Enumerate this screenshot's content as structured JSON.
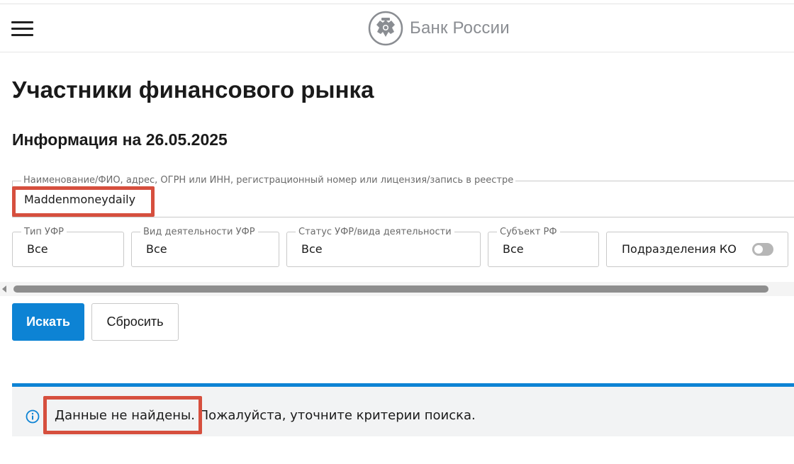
{
  "header": {
    "menu_icon": "hamburger-menu-icon",
    "logo_icon": "double-headed-eagle-emblem",
    "logo_text": "Банк России"
  },
  "page": {
    "title": "Участники финансового рынка",
    "info_date": "Информация на 26.05.2025"
  },
  "search": {
    "legend": "Наименование/ФИО, адрес, ОГРН или ИНН, регистрационный номер или лицензия/запись в реестре",
    "value": "Maddenmoneydaily"
  },
  "filters": [
    {
      "label": "Тип УФР",
      "value": "Все"
    },
    {
      "label": "Вид деятельности УФР",
      "value": "Все"
    },
    {
      "label": "Статус УФР/вида деятельности",
      "value": "Все"
    },
    {
      "label": "Субъект РФ",
      "value": "Все"
    }
  ],
  "toggle": {
    "label": "Подразделения КО",
    "checked": false
  },
  "buttons": {
    "search": "Искать",
    "reset": "Сбросить"
  },
  "notice": {
    "icon": "info-icon",
    "text": "Данные не найдены. Пожалуйста, уточните критерии поиска."
  },
  "colors": {
    "accent": "#0d83d4",
    "highlight": "#d64f3e",
    "logo_gray": "#8a8d92",
    "notice_bg": "#f2f3f4"
  }
}
